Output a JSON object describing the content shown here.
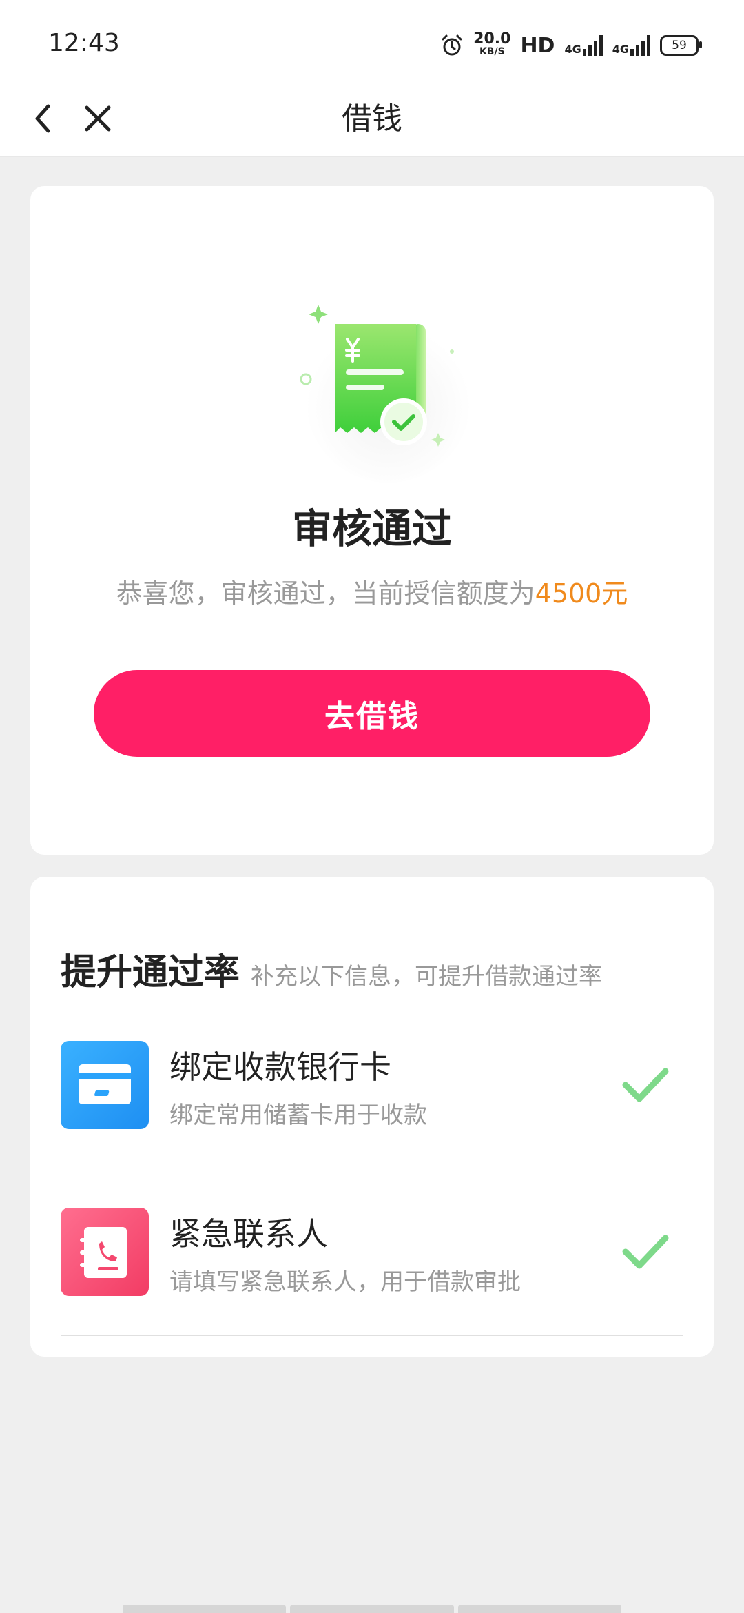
{
  "status_bar": {
    "time": "12:43",
    "speed_value": "20.0",
    "speed_unit": "KB/S",
    "hd_label": "HD",
    "net_1": "4G",
    "net_2": "4G",
    "battery": "59",
    "icons": [
      "alarm-icon",
      "signal-icon",
      "battery-icon"
    ]
  },
  "nav": {
    "title": "借钱",
    "back_icon": "chevron-left-icon",
    "close_icon": "close-icon"
  },
  "result": {
    "illustration_icon": "approved-receipt-icon",
    "title": "审核通过",
    "desc_prefix": "恭喜您，审核通过，当前授信额度为",
    "amount": "4500元",
    "button_label": "去借钱"
  },
  "boost": {
    "title": "提升通过率",
    "subtitle": "补充以下信息，可提升借款通过率",
    "items": [
      {
        "icon": "bank-card-icon",
        "title": "绑定收款银行卡",
        "desc": "绑定常用储蓄卡用于收款",
        "status_icon": "check-icon"
      },
      {
        "icon": "contact-book-icon",
        "title": "紧急联系人",
        "desc": "请填写紧急联系人，用于借款审批",
        "status_icon": "check-icon"
      }
    ]
  },
  "colors": {
    "accent": "#ff1f66",
    "amount": "#f08a1c",
    "check": "#7ed98a",
    "card_icon_blue": "#2aa3fb",
    "card_icon_pink": "#f4476e",
    "illustration_green": "#58d640"
  }
}
